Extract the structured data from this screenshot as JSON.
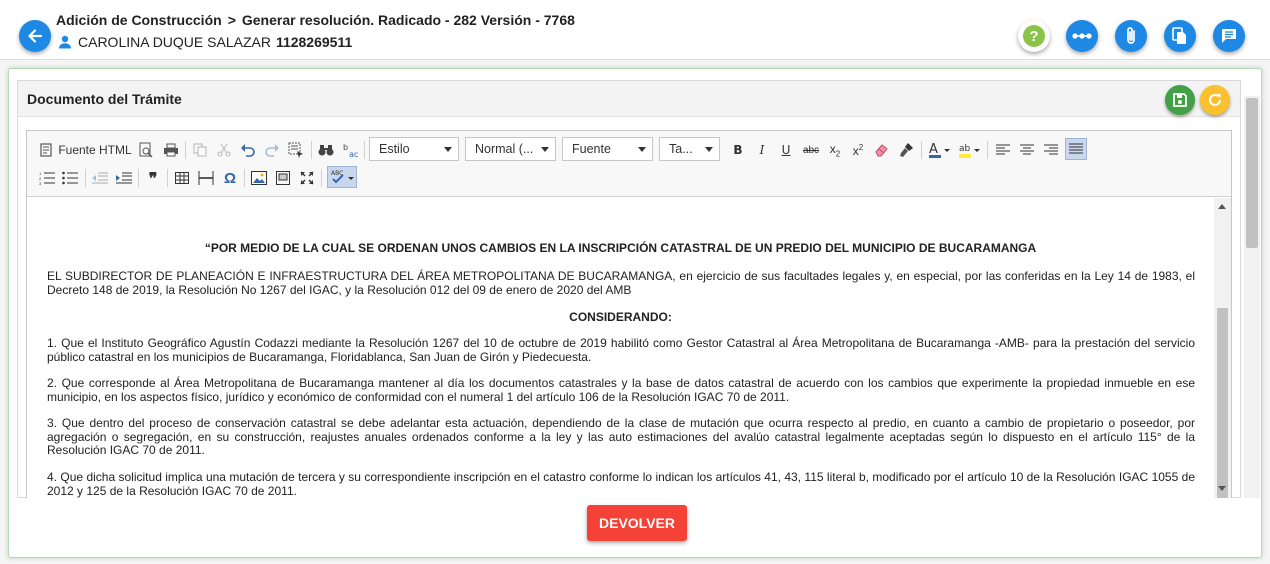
{
  "header": {
    "breadcrumb_1": "Adición de Construcción",
    "breadcrumb_sep": ">",
    "breadcrumb_2": "Generar resolución. Radicado - 282 Versión - 7768",
    "user_name": "CAROLINA DUQUE SALAZAR",
    "user_id": "1128269511"
  },
  "header_buttons": [
    {
      "name": "help-button",
      "icon": "question-icon",
      "color": "#8bc34a"
    },
    {
      "name": "workflow-button",
      "icon": "flow-icon",
      "color": "#1e88e5"
    },
    {
      "name": "attachments-button",
      "icon": "paperclip-icon",
      "color": "#1e88e5"
    },
    {
      "name": "documents-button",
      "icon": "copy-icon",
      "color": "#1e88e5"
    },
    {
      "name": "comments-button",
      "icon": "comment-icon",
      "color": "#1e88e5"
    }
  ],
  "panel": {
    "title": "Documento del Trámite",
    "save_color": "#43a047",
    "refresh_color": "#fbc02d"
  },
  "toolbar": {
    "source_label": "Fuente HTML",
    "style_combo": "Estilo",
    "format_combo": "Normal (...",
    "font_combo": "Fuente",
    "size_combo": "Ta..."
  },
  "document": {
    "title": "“POR MEDIO DE LA CUAL SE ORDENAN UNOS CAMBIOS EN LA INSCRIPCIÓN CATASTRAL DE UN PREDIO DEL MUNICIPIO DE BUCARAMANGA",
    "intro": "EL SUBDIRECTOR DE PLANEACIÓN E INFRAESTRUCTURA DEL ÁREA METROPOLITANA DE BUCARAMANGA, en ejercicio de sus facultades legales y, en especial, por las conferidas en la Ley 14 de 1983, el Decreto 148 de 2019, la Resolución No 1267 del IGAC, y la Resolución 012 del 09 de enero de 2020 del AMB",
    "considerando": "CONSIDERANDO:",
    "items": [
      "1. Que el Instituto Geográfico Agustín Codazzi mediante la Resolución 1267 del 10 de octubre de 2019 habilitó como Gestor Catastral al Área Metropolitana de Bucaramanga -AMB- para la prestación del servicio público catastral en los municipios de Bucaramanga, Floridablanca, San Juan de Girón y Piedecuesta.",
      "2. Que corresponde al Área Metropolitana de Bucaramanga mantener al día los documentos catastrales y la base de datos catastral de acuerdo con los cambios que experimente la propiedad inmueble en ese municipio, en los aspectos físico, jurídico y económico de conformidad con el numeral 1 del artículo 106 de la Resolución IGAC 70 de 2011.",
      "3. Que dentro del proceso de conservación catastral se debe adelantar esta actuación, dependiendo de la clase de mutación que ocurra respecto al predio, en cuanto a cambio de propietario o poseedor, por agregación o segregación, en su construcción, reajustes anuales ordenados conforme a la ley y las auto estimaciones del avalúo catastral legalmente aceptadas según lo dispuesto en el artículo 115° de la Resolución IGAC 70 de 2011.",
      "4. Que dicha solicitud implica una mutación de tercera y su correspondiente inscripción en el catastro conforme lo indican los artículos 41, 43, 115 literal b, modificado por el artículo 10 de la Resolución IGAC 1055 de 2012 y 125 de la Resolución IGAC 70 de 2011."
    ]
  },
  "footer": {
    "devolver_label": "DEVOLVER",
    "devolver_color": "#f44336"
  }
}
